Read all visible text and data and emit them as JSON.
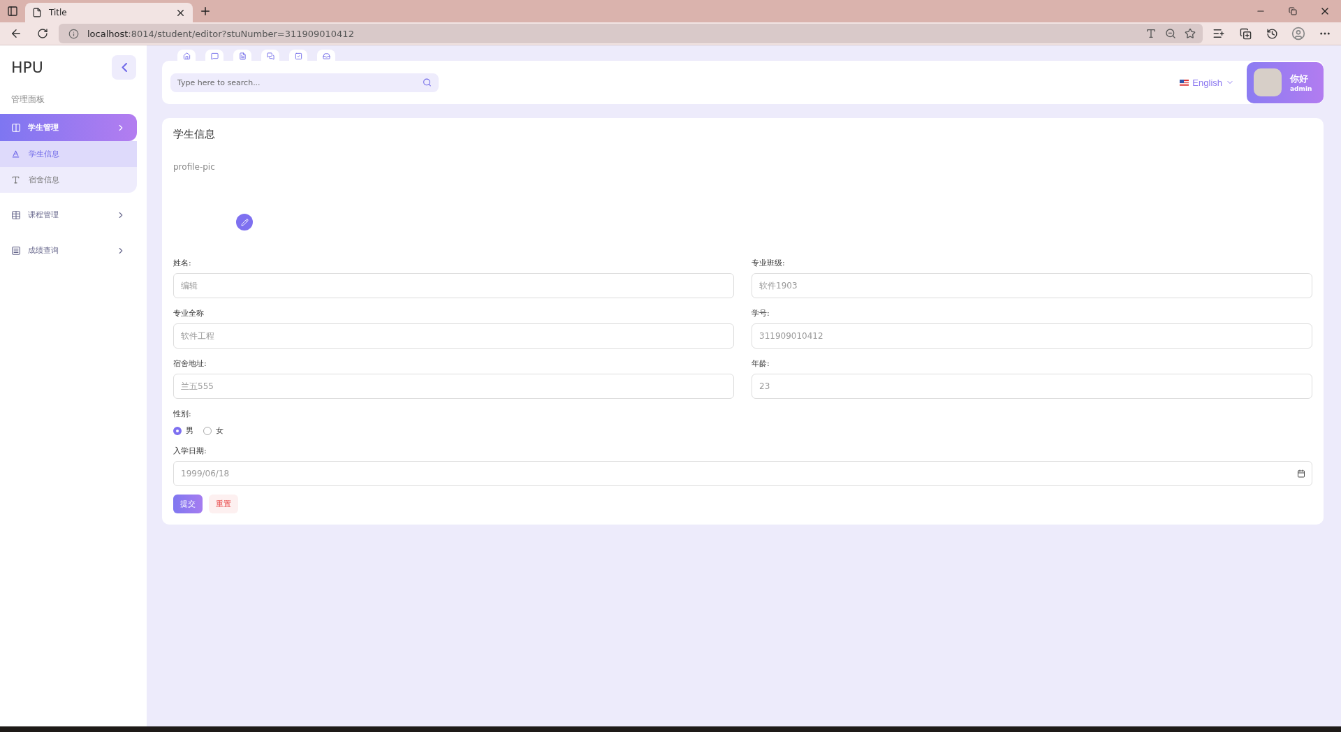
{
  "browser": {
    "tab_title": "Title",
    "url_host": "localhost",
    "url_path": ":8014/student/editor?stuNumber=311909010412"
  },
  "sidebar": {
    "brand": "HPU",
    "section": "管理面板",
    "items": [
      {
        "label": "学生管理",
        "selected": true,
        "expanded": true,
        "children": [
          {
            "label": "学生信息",
            "selected": true
          },
          {
            "label": "宿舍信息",
            "selected": false
          }
        ]
      },
      {
        "label": "课程管理",
        "selected": false
      },
      {
        "label": "成绩查询",
        "selected": false
      }
    ]
  },
  "header": {
    "search_placeholder": "Type here to search...",
    "language": "English",
    "greeting": "你好",
    "role": "admin"
  },
  "card": {
    "title": "学生信息",
    "profile_alt": "profile-pic",
    "fields": [
      {
        "label": "姓名:",
        "placeholder": "编辑"
      },
      {
        "label": "专业班级:",
        "placeholder": "软件1903"
      },
      {
        "label": "专业全称",
        "placeholder": "软件工程"
      },
      {
        "label": "学号:",
        "placeholder": "311909010412"
      },
      {
        "label": "宿舍地址:",
        "placeholder": "兰五555"
      },
      {
        "label": "年龄:",
        "placeholder": "23"
      }
    ],
    "gender": {
      "label": "性别:",
      "options": [
        {
          "label": "男",
          "selected": true
        },
        {
          "label": "女",
          "selected": false
        }
      ]
    },
    "date": {
      "label": "入学日期:",
      "placeholder": "1999/06/18"
    },
    "buttons": [
      {
        "label": "提交",
        "kind": "primary"
      },
      {
        "label": "重置",
        "kind": "danger"
      }
    ]
  }
}
